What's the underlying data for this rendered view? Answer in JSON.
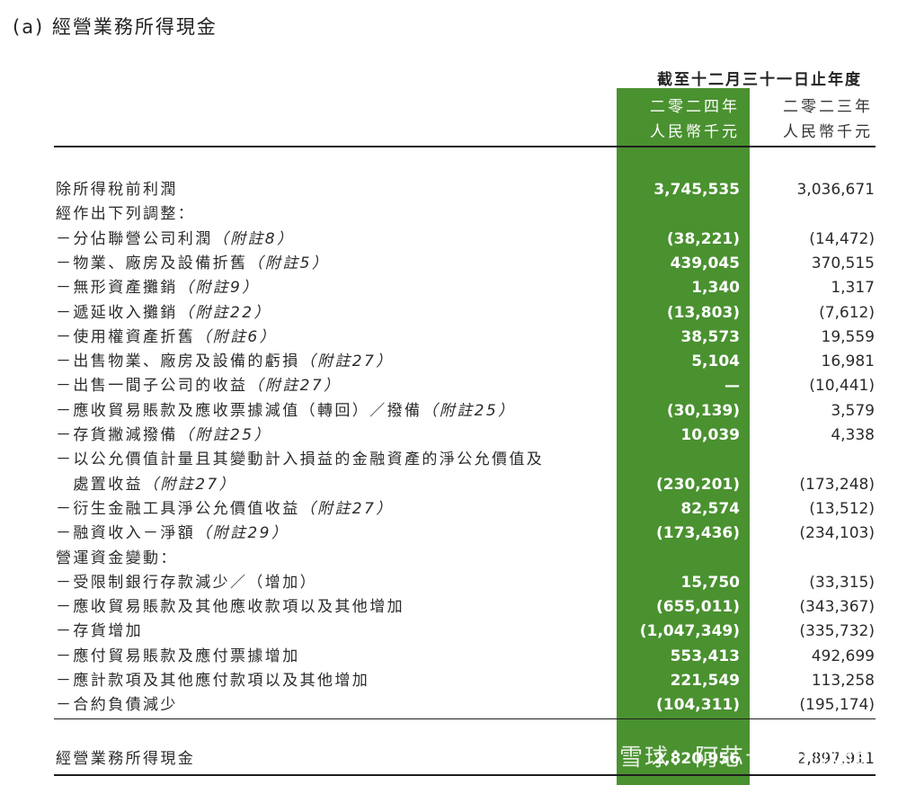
{
  "section_title": "(a)  經營業務所得現金",
  "period_header": "截至十二月三十一日止年度",
  "columns": {
    "current": {
      "year": "二零二四年",
      "unit": "人民幣千元"
    },
    "prior": {
      "year": "二零二三年",
      "unit": "人民幣千元"
    }
  },
  "rows": [
    {
      "label": "除所得稅前利潤",
      "note": "",
      "current": "3,745,535",
      "prior": "3,036,671"
    },
    {
      "label": "經作出下列調整：",
      "note": "",
      "current": "",
      "prior": ""
    },
    {
      "label": "－分佔聯營公司利潤",
      "note": "（附註8）",
      "current": "(38,221)",
      "prior": "(14,472)"
    },
    {
      "label": "－物業、廠房及設備折舊",
      "note": "（附註5）",
      "current": "439,045",
      "prior": "370,515"
    },
    {
      "label": "－無形資產攤銷",
      "note": "（附註9）",
      "current": "1,340",
      "prior": "1,317"
    },
    {
      "label": "－遞延收入攤銷",
      "note": "（附註22）",
      "current": "(13,803)",
      "prior": "(7,612)"
    },
    {
      "label": "－使用權資產折舊",
      "note": "（附註6）",
      "current": "38,573",
      "prior": "19,559"
    },
    {
      "label": "－出售物業、廠房及設備的虧損",
      "note": "（附註27）",
      "current": "5,104",
      "prior": "16,981"
    },
    {
      "label": "－出售一間子公司的收益",
      "note": "（附註27）",
      "current": "—",
      "prior": "(10,441)"
    },
    {
      "label": "－應收貿易賬款及應收票據減值（轉回）／撥備",
      "note": "（附註25）",
      "current": "(30,139)",
      "prior": "3,579"
    },
    {
      "label": "－存貨撇減撥備",
      "note": "（附註25）",
      "current": "10,039",
      "prior": "4,338"
    },
    {
      "label": "－以公允價值計量且其變動計入損益的金融資產的淨公允價值及",
      "note": "",
      "current": "",
      "prior": ""
    },
    {
      "label": "　處置收益",
      "note": "（附註27）",
      "current": "(230,201)",
      "prior": "(173,248)"
    },
    {
      "label": "－衍生金融工具淨公允價值收益",
      "note": "（附註27）",
      "current": "82,574",
      "prior": "(13,512)"
    },
    {
      "label": "－融資收入－淨額",
      "note": "（附註29）",
      "current": "(173,436)",
      "prior": "(234,103)"
    },
    {
      "label": "營運資金變動：",
      "note": "",
      "current": "",
      "prior": ""
    },
    {
      "label": "－受限制銀行存款減少／（增加）",
      "note": "",
      "current": "15,750",
      "prior": "(33,315)"
    },
    {
      "label": "－應收貿易賬款及其他應收款項以及其他增加",
      "note": "",
      "current": "(655,011)",
      "prior": "(343,367)"
    },
    {
      "label": "－存貨增加",
      "note": "",
      "current": "(1,047,349)",
      "prior": "(335,732)"
    },
    {
      "label": "－應付貿易賬款及應付票據增加",
      "note": "",
      "current": "553,413",
      "prior": "492,699"
    },
    {
      "label": "－應計款項及其他應付款項以及其他增加",
      "note": "",
      "current": "221,549",
      "prior": "113,258"
    },
    {
      "label": "－合約負債減少",
      "note": "",
      "current": "(104,311)",
      "prior": "(195,174)"
    }
  ],
  "total": {
    "label": "經營業務所得現金",
    "current": "2,820,956",
    "prior": "2,897,911"
  },
  "watermark": "雪球：阿芯卡班的风传",
  "colors": {
    "highlight_column": "#4a9130",
    "text": "#2b2b2b",
    "rule": "#1e1e1e"
  }
}
